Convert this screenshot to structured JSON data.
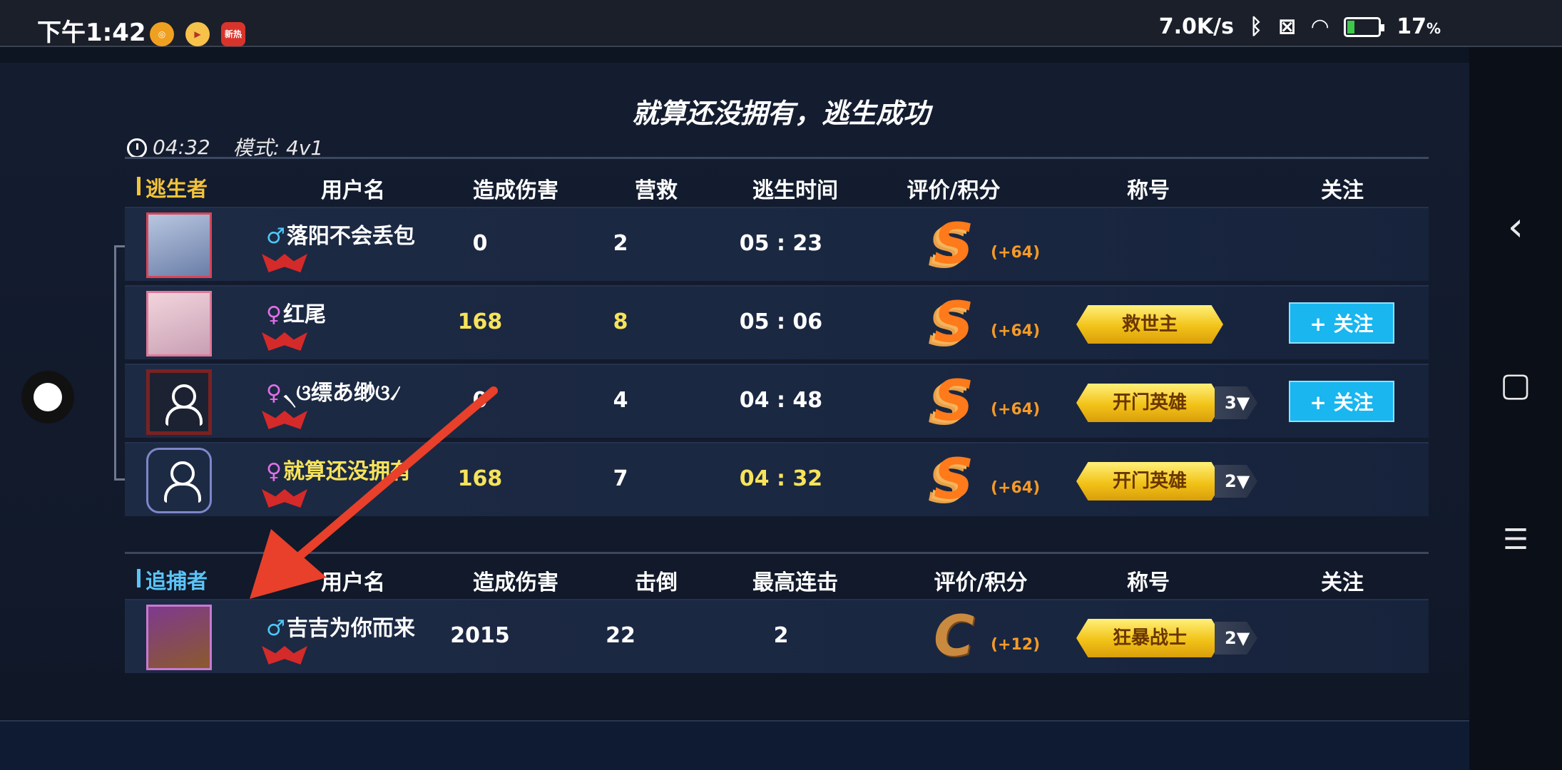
{
  "status_bar": {
    "time": "下午1:42",
    "app_icons": [
      "fingerprint-app-icon",
      "video-app-icon",
      "news-app-icon"
    ],
    "news_app_label": "新热",
    "net_speed": "7.0K/s",
    "battery": "17"
  },
  "panel": {
    "title": "就算还没拥有，逃生成功",
    "duration": "04:32",
    "mode": "模式: 4v1"
  },
  "survivors": {
    "section_label": "逃生者",
    "headers": [
      "用户名",
      "造成伤害",
      "营救",
      "逃生时间",
      "评价/积分",
      "称号",
      "关注"
    ],
    "rows": [
      {
        "gender": "♂",
        "name": "落阳不会丢包",
        "damage": "0",
        "rescue": "2",
        "escape_time": "05 : 23",
        "grade": "S",
        "points": "(+64)",
        "title": "",
        "title_count": "",
        "follow": ""
      },
      {
        "gender": "♀",
        "name": "红尾",
        "damage": "168",
        "rescue": "8",
        "escape_time": "05 : 06",
        "grade": "S",
        "points": "(+64)",
        "title": "救世主",
        "title_count": "",
        "follow": "+ 关注"
      },
      {
        "gender": "♀",
        "name": "৲ଓ缥あ缈ଓ৴",
        "damage": "0",
        "rescue": "4",
        "escape_time": "04 : 48",
        "grade": "S",
        "points": "(+64)",
        "title": "开门英雄",
        "title_count": "3▼",
        "follow": "+ 关注"
      },
      {
        "gender": "♀",
        "name": "就算还没拥有",
        "damage": "168",
        "rescue": "7",
        "escape_time": "04 : 32",
        "grade": "S",
        "points": "(+64)",
        "title": "开门英雄",
        "title_count": "2▼",
        "follow": ""
      }
    ]
  },
  "hunters": {
    "section_label": "追捕者",
    "headers": [
      "用户名",
      "造成伤害",
      "击倒",
      "最高连击",
      "评价/积分",
      "称号",
      "关注"
    ],
    "rows": [
      {
        "gender": "♂",
        "name": "吉吉为你而来",
        "damage": "2015",
        "knockdowns": "22",
        "max_combo": "2",
        "grade": "C",
        "points": "(+12)",
        "title": "狂暴战士",
        "title_count": "2▼"
      }
    ]
  },
  "nav": {
    "back": "‹",
    "home": "▢",
    "menu": "☰",
    "close": "✕"
  },
  "colors": {
    "survivor_label": "#f3c33a",
    "hunter_label": "#5bc4f7",
    "highlight_value": "#f7e35a",
    "follow_button": "#19b6f0",
    "grade_points": "#f59a28",
    "annotation_arrow": "#e8402a"
  }
}
